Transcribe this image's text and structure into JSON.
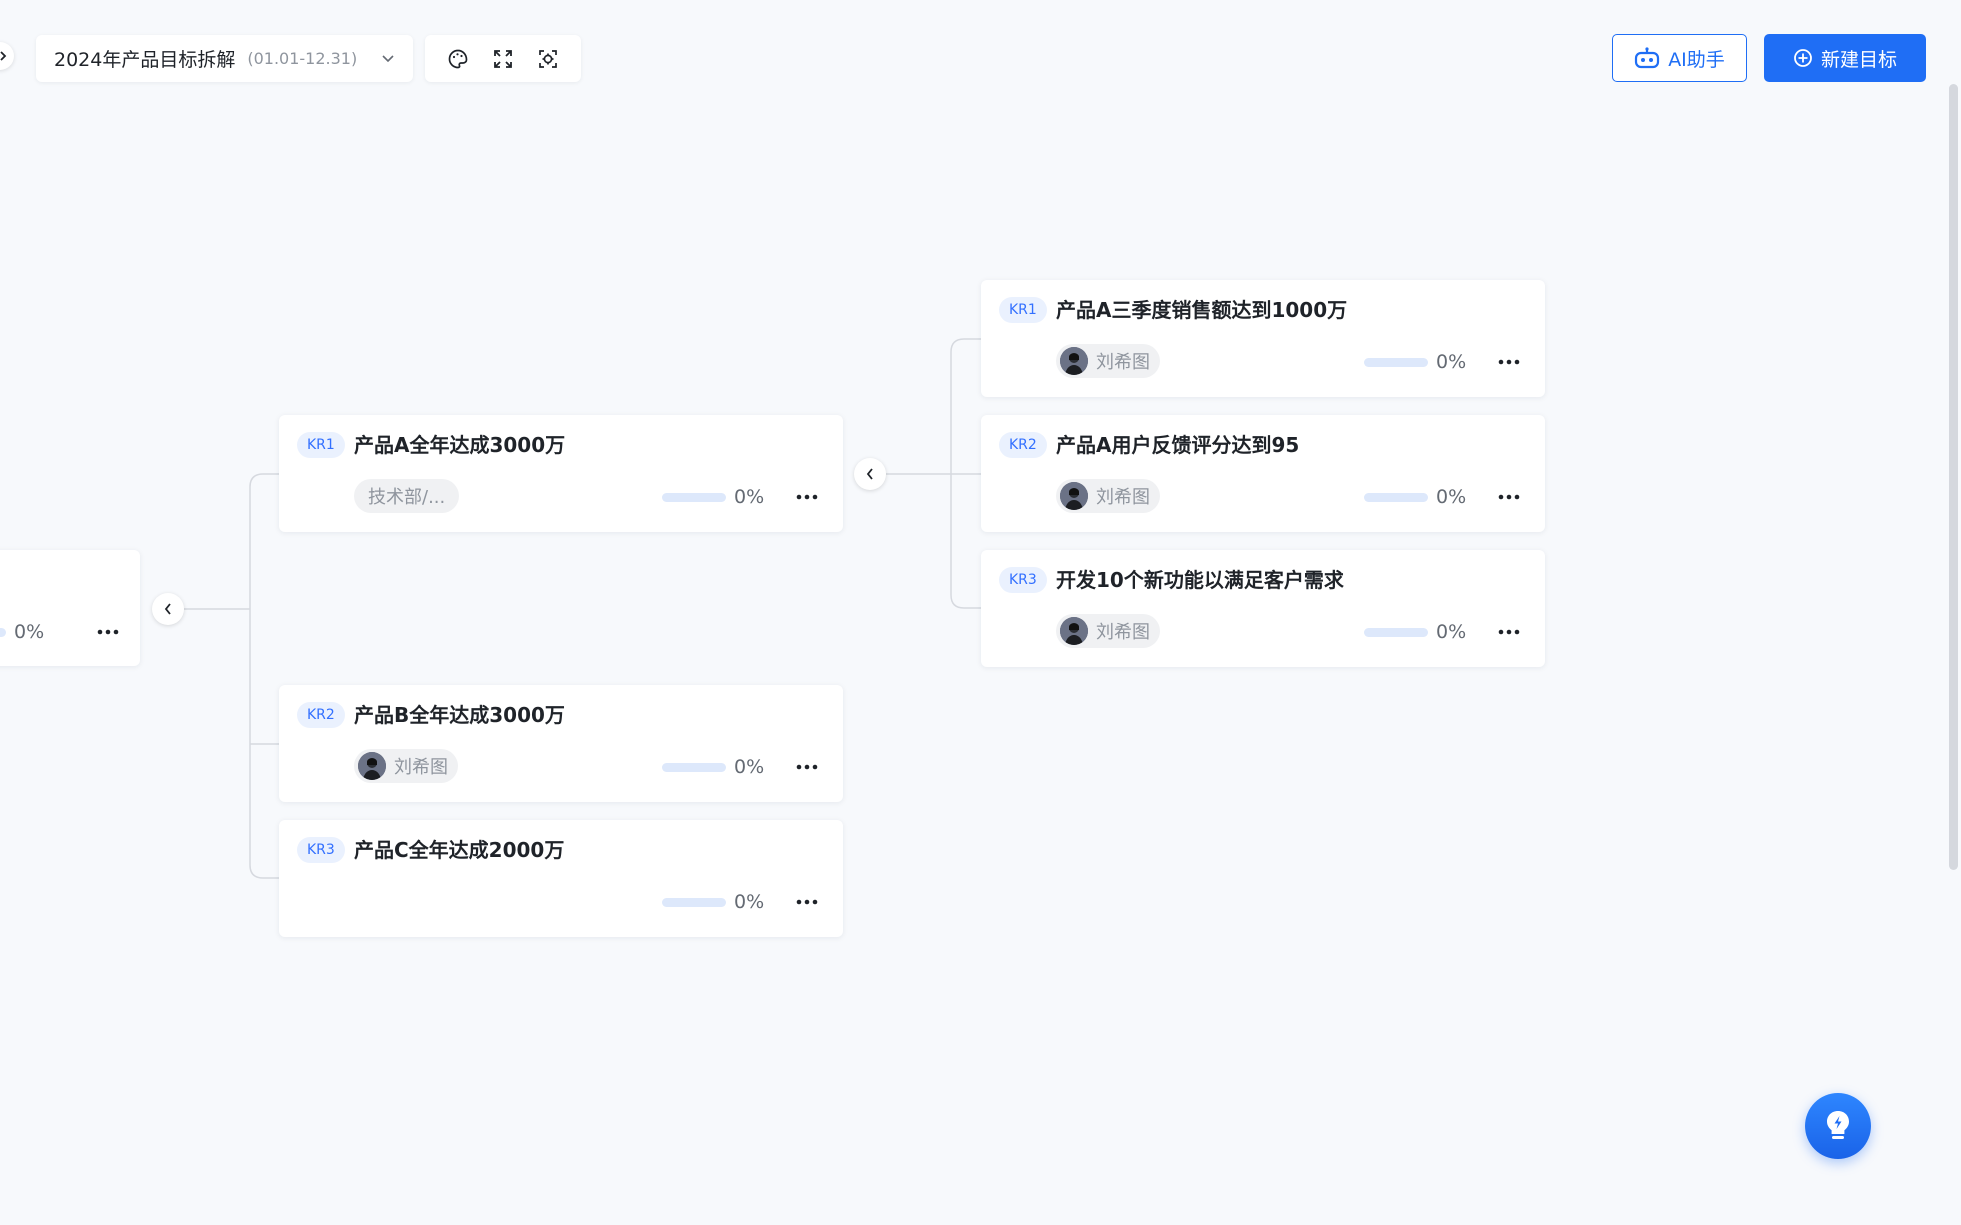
{
  "toolbar": {
    "plan_title": "2024年产品目标拆解",
    "plan_range": "(01.01-12.31)",
    "ai_label": "AI助手",
    "new_label": "新建目标"
  },
  "colors": {
    "accent": "#1f6ef5",
    "kr_badge_bg": "#eaf1fe",
    "kr_badge_text": "#3370ff",
    "progress_track": "#dde8fb"
  },
  "root": {
    "progress_label": "0%",
    "progress": 0
  },
  "level1": [
    {
      "kr": "KR1",
      "title": "产品A全年达成3000万",
      "owner": "技术部/...",
      "owner_type": "department",
      "progress_label": "0%",
      "progress": 0
    },
    {
      "kr": "KR2",
      "title": "产品B全年达成3000万",
      "owner": "刘希图",
      "owner_type": "person",
      "progress_label": "0%",
      "progress": 0
    },
    {
      "kr": "KR3",
      "title": "产品C全年达成2000万",
      "owner": "",
      "owner_type": "none",
      "progress_label": "0%",
      "progress": 0
    }
  ],
  "level2": [
    {
      "kr": "KR1",
      "title": "产品A三季度销售额达到1000万",
      "owner": "刘希图",
      "owner_type": "person",
      "progress_label": "0%",
      "progress": 0
    },
    {
      "kr": "KR2",
      "title": "产品A用户反馈评分达到95",
      "owner": "刘希图",
      "owner_type": "person",
      "progress_label": "0%",
      "progress": 0
    },
    {
      "kr": "KR3",
      "title": "开发10个新功能以满足客户需求",
      "owner": "刘希图",
      "owner_type": "person",
      "progress_label": "0%",
      "progress": 0
    }
  ]
}
